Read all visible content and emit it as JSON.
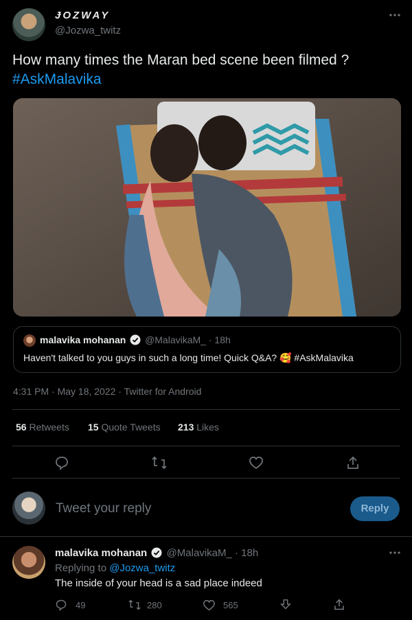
{
  "tweet": {
    "display_name": "ɈOZWAY",
    "handle": "@Jozwa_twitz",
    "more_icon": "more-horizontal-icon",
    "text_line1": "How many times  the Maran bed scene been filmed ?",
    "hashtag": "#AskMalavika",
    "timestamp": "4:31 PM · May 18, 2022 · Twitter for Android"
  },
  "quoted": {
    "name": "malavika mohanan",
    "handle": "@MalavikaM_",
    "time": "· 18h",
    "text": "Haven't talked to you guys in such a long time! Quick Q&A?",
    "emoji": "🥰",
    "hashtag": "#AskMalavika"
  },
  "stats": {
    "retweets_count": "56",
    "retweets_label": "Retweets",
    "quotes_count": "15",
    "quotes_label": "Quote Tweets",
    "likes_count": "213",
    "likes_label": "Likes"
  },
  "compose": {
    "placeholder": "Tweet your reply",
    "button": "Reply"
  },
  "reply": {
    "name": "malavika mohanan",
    "handle": "@MalavikaM_",
    "time": "· 18h",
    "replying_to_label": "Replying to",
    "replying_to_handle": "@Jozwa_twitz",
    "text": "The inside of your head is a sad place indeed",
    "comments": "49",
    "retweets": "280",
    "likes": "565"
  },
  "colors": {
    "accent": "#1d9bf0",
    "background": "#000000",
    "muted": "#71767b",
    "divider": "#2f3336"
  }
}
